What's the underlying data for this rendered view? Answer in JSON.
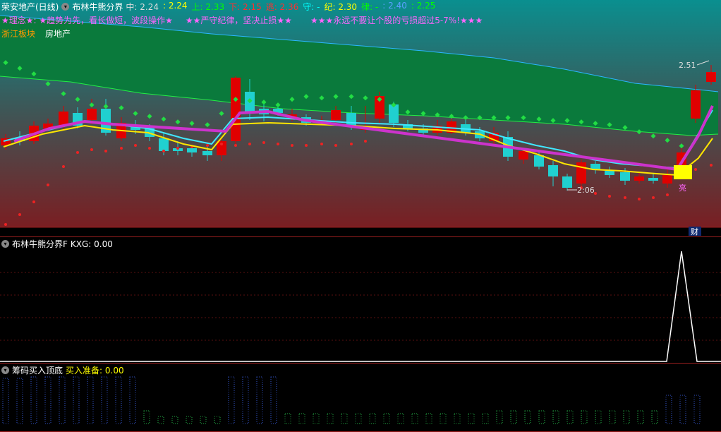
{
  "header": {
    "stock_name": "荣安地产(日线)",
    "indicator": "布林牛熊分界",
    "values": [
      {
        "label": "中:",
        "value": "2.24",
        "color": "#dddddd"
      },
      {
        "label": ":",
        "value": "2.24",
        "color": "#ffff00"
      },
      {
        "label": "上:",
        "value": "2.33",
        "color": "#00ff00"
      },
      {
        "label": "下:",
        "value": "2.15",
        "color": "#ff3030"
      },
      {
        "label": "逃:",
        "value": "2.36",
        "color": "#ff3030"
      },
      {
        "label": "守:",
        "value": "-",
        "color": "#00ffff"
      },
      {
        "label": "纪:",
        "value": "2.30",
        "color": "#ffff00"
      },
      {
        "label": "律:",
        "value": "-",
        "color": "#00ff00"
      },
      {
        "label": ":",
        "value": "2.40",
        "color": "#5aa0ff"
      },
      {
        "label": ":",
        "value": "2.25",
        "color": "#00ff00"
      }
    ]
  },
  "motto": {
    "a": "★理念★: ★趋势为先，看长做短，波段操作★",
    "b": "★★严守纪律，坚决止损★★",
    "c": "★★★永远不要让个股的亏损超过5-7%!★★★"
  },
  "sector": {
    "region": "浙江板块",
    "industry": "房地产"
  },
  "main_chart": {
    "high_label": "2.51",
    "low_label": "2:06",
    "signal_label": "亮",
    "finance_label": "财"
  },
  "panel2": {
    "title": "布林牛熊分界F",
    "field": "KXG: 0.00"
  },
  "panel3": {
    "title": "筹码买入顶底",
    "field": "买入准备: 0.00"
  },
  "colors": {
    "up": "#e00000",
    "down": "#20d0d0",
    "accent": "#ff66ff",
    "green": "#00cc33"
  }
}
